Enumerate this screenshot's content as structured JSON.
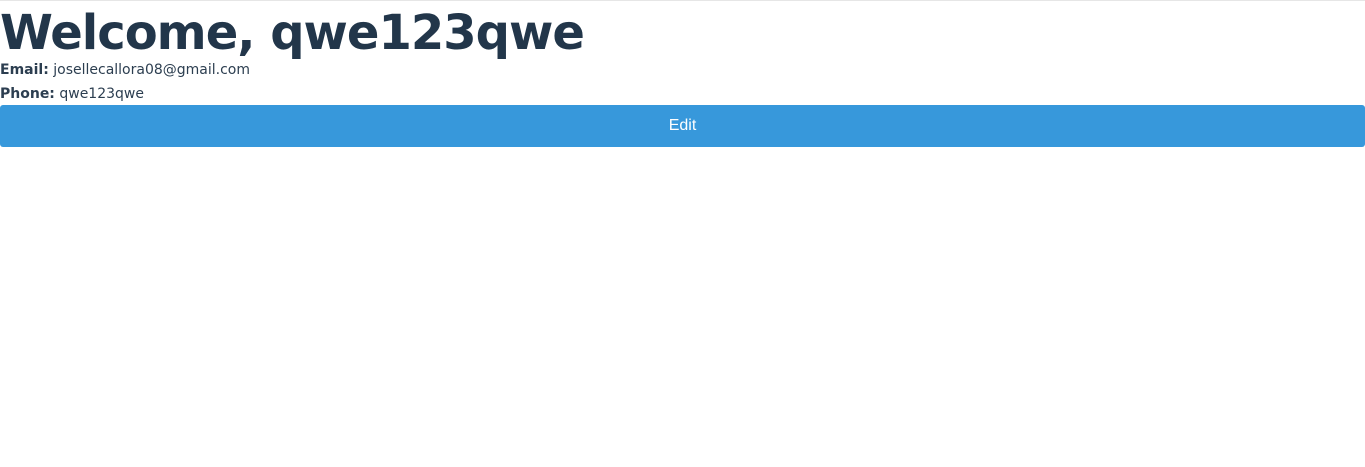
{
  "profile": {
    "welcome_prefix": "Welcome, ",
    "username": "qwe123qwe",
    "email_label": "Email:",
    "email_value": "josellecallora08@gmail.com",
    "phone_label": "Phone:",
    "phone_value": "qwe123qwe",
    "edit_label": "Edit"
  },
  "colors": {
    "heading": "#22364a",
    "text": "#2c3e50",
    "button_bg": "#3798db",
    "button_text": "#ffffff"
  }
}
